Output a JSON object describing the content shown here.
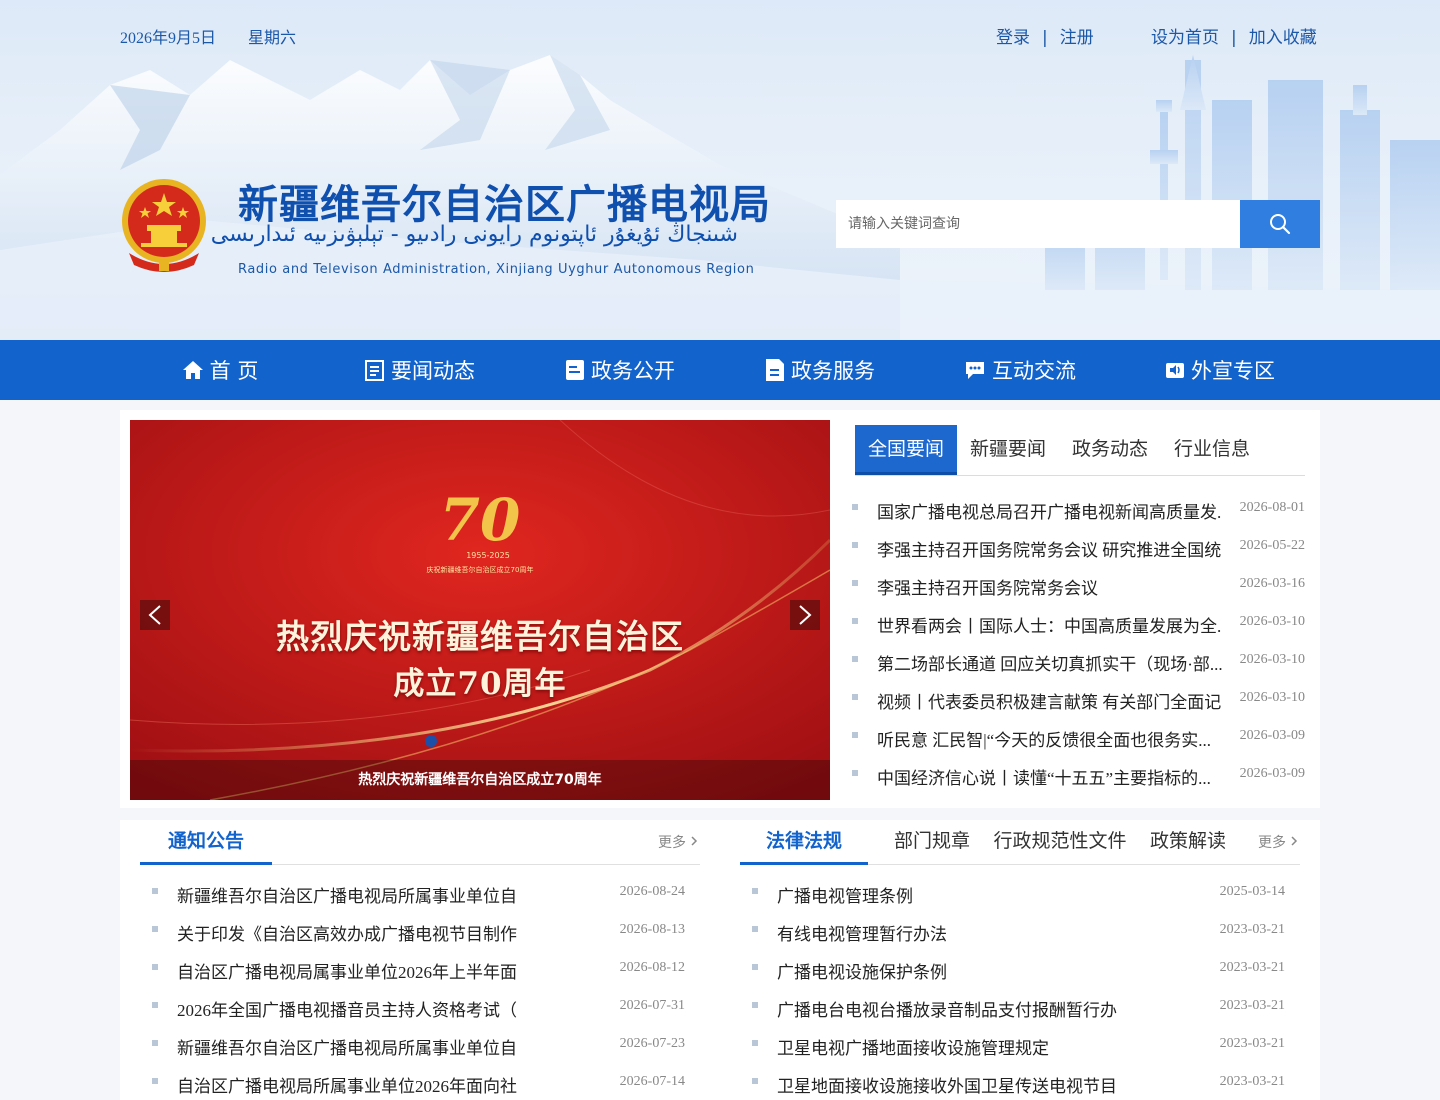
{
  "topbar": {
    "date": "2026年9月5日",
    "weekday": "星期六",
    "login": "登录",
    "sep": "|",
    "register": "注册",
    "set_home": "设为首页",
    "add_favorite": "加入收藏"
  },
  "header": {
    "title_cn": "新疆维吾尔自治区广播电视局",
    "title_ug": "شىنجاڭ ئۇيغۇر ئاپتونوم رايونى رادىيو - تېلېۋىزىيە ئىدارىسى",
    "title_en": "Radio and Televison Administration, Xinjiang Uyghur Autonomous Region"
  },
  "search": {
    "placeholder": "请输入关键词查询"
  },
  "nav": {
    "items": [
      {
        "label": "首 页",
        "icon": "home-icon"
      },
      {
        "label": "要闻动态",
        "icon": "news-icon"
      },
      {
        "label": "政务公开",
        "icon": "book-icon"
      },
      {
        "label": "政务服务",
        "icon": "document-icon"
      },
      {
        "label": "互动交流",
        "icon": "chat-icon"
      },
      {
        "label": "外宣专区",
        "icon": "speaker-icon"
      }
    ]
  },
  "carousel": {
    "badge_number": "70",
    "badge_years": "1955-2025",
    "badge_text": "庆祝新疆维吾尔自治区成立70周年",
    "headline1": "热烈庆祝新疆维吾尔自治区",
    "headline2": "成立70周年",
    "caption": "热烈庆祝新疆维吾尔自治区成立70周年"
  },
  "news": {
    "tabs": [
      "全国要闻",
      "新疆要闻",
      "政务动态",
      "行业信息"
    ],
    "items": [
      {
        "title": "国家广播电视总局召开广播电视新闻高质量发...",
        "date": "2026-08-01"
      },
      {
        "title": "李强主持召开国务院常务会议 研究推进全国统...",
        "date": "2026-05-22"
      },
      {
        "title": "李强主持召开国务院常务会议",
        "date": "2026-03-16"
      },
      {
        "title": "世界看两会丨国际人士：中国高质量发展为全...",
        "date": "2026-03-10"
      },
      {
        "title": "第二场部长通道 回应关切真抓实干（现场·部...",
        "date": "2026-03-10"
      },
      {
        "title": "视频丨代表委员积极建言献策 有关部门全面记...",
        "date": "2026-03-10"
      },
      {
        "title": "听民意 汇民智|“今天的反馈很全面也很务实...",
        "date": "2026-03-09"
      },
      {
        "title": "中国经济信心说丨读懂“十五五”主要指标的...",
        "date": "2026-03-09"
      }
    ]
  },
  "notices": {
    "tab": "通知公告",
    "more": "更多",
    "items": [
      {
        "title": "新疆维吾尔自治区广播电视局所属事业单位自...",
        "date": "2026-08-24"
      },
      {
        "title": "关于印发《自治区高效办成广播电视节目制作...",
        "date": "2026-08-13"
      },
      {
        "title": "自治区广播电视局属事业单位2026年上半年面...",
        "date": "2026-08-12"
      },
      {
        "title": "2026年全国广播电视播音员主持人资格考试（...",
        "date": "2026-07-31"
      },
      {
        "title": "新疆维吾尔自治区广播电视局所属事业单位自...",
        "date": "2026-07-23"
      },
      {
        "title": "自治区广播电视局所属事业单位2026年面向社...",
        "date": "2026-07-14"
      }
    ]
  },
  "laws": {
    "tabs": [
      "法律法规",
      "部门规章",
      "行政规范性文件",
      "政策解读"
    ],
    "more": "更多",
    "items": [
      {
        "title": "广播电视管理条例",
        "date": "2025-03-14"
      },
      {
        "title": "有线电视管理暂行办法",
        "date": "2023-03-21"
      },
      {
        "title": "广播电视设施保护条例",
        "date": "2023-03-21"
      },
      {
        "title": "广播电台电视台播放录音制品支付报酬暂行办...",
        "date": "2023-03-21"
      },
      {
        "title": "卫星电视广播地面接收设施管理规定",
        "date": "2023-03-21"
      },
      {
        "title": "卫星地面接收设施接收外国卫星传送电视节目...",
        "date": "2023-03-21"
      }
    ]
  },
  "colors": {
    "nav_blue": "#1363cc",
    "title_blue": "#0f4fae",
    "banner_red": "#b4141a"
  }
}
